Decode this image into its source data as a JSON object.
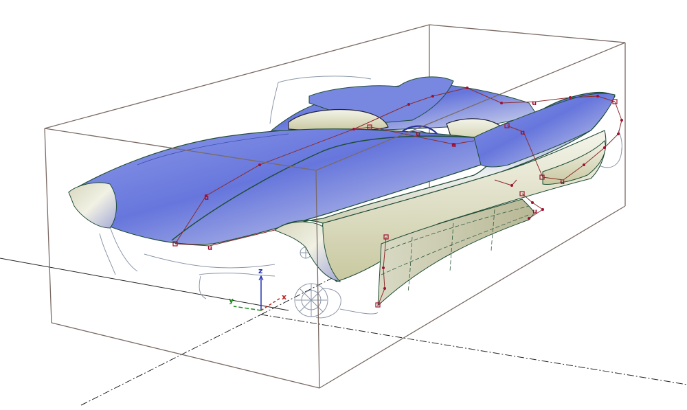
{
  "viewport": {
    "axis_labels": {
      "x": "x",
      "y": "y",
      "z": "z"
    },
    "cv_marker_label": "u",
    "colors": {
      "background": "#ffffff",
      "bounding_box": "#7a6a64",
      "surface_blue": "#6f7fe0",
      "surface_light": "#cfd3ea",
      "surface_cream": "#e4e4cc",
      "surface_edge": "#1f4d36",
      "cv_hull": "#8a2a2a",
      "cv_marker": "#a01030",
      "wireframe": "#8a96a8",
      "axis_x": "#c02020",
      "axis_y": "#1d8a1d",
      "axis_z": "#2030b0",
      "ground_line": "#222222"
    }
  }
}
